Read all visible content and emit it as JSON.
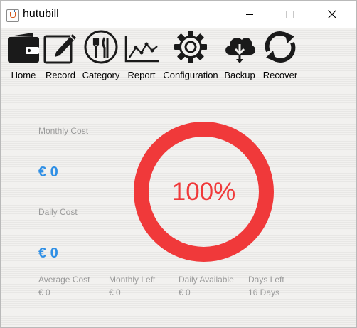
{
  "window": {
    "title": "hutubill"
  },
  "toolbar": {
    "items": [
      {
        "label": "Home",
        "icon": "wallet-icon"
      },
      {
        "label": "Record",
        "icon": "edit-icon"
      },
      {
        "label": "Category",
        "icon": "utensils-icon"
      },
      {
        "label": "Report",
        "icon": "line-chart-icon"
      },
      {
        "label": "Configuration",
        "icon": "gear-icon"
      },
      {
        "label": "Backup",
        "icon": "cloud-download-icon"
      },
      {
        "label": "Recover",
        "icon": "refresh-icon"
      }
    ]
  },
  "summary": {
    "monthly_cost_label": "Monthly Cost",
    "monthly_cost_value": "€ 0",
    "daily_cost_label": "Daily Cost",
    "daily_cost_value": "€ 0",
    "progress_text": "100%",
    "progress_fraction": 1.0,
    "progress_color": "#f0393a",
    "value_color": "#2f8fe5"
  },
  "stats": [
    {
      "label": "Average Cost",
      "value": "€ 0"
    },
    {
      "label": "Monthly Left",
      "value": "€ 0"
    },
    {
      "label": "Daily Available",
      "value": "€ 0"
    },
    {
      "label": "Days Left",
      "value": "16 Days"
    }
  ]
}
